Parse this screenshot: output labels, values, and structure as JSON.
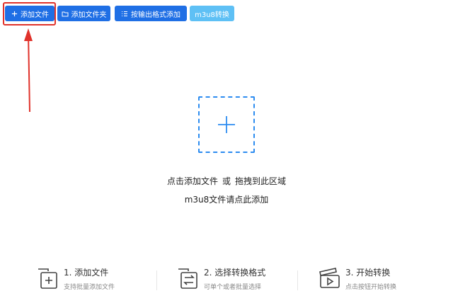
{
  "toolbar": {
    "add_file": "添加文件",
    "add_folder": "添加文件夹",
    "add_by_format": "按输出格式添加",
    "m3u8": "m3u8转换"
  },
  "dropzone": {
    "hint_left": "点击添加文件",
    "hint_or": "或",
    "hint_right": "拖拽到此区域",
    "hint_m3u8": "m3u8文件请点此添加"
  },
  "steps": [
    {
      "title": "1. 添加文件",
      "desc": "支持批量添加文件",
      "icon": "add-file-icon"
    },
    {
      "title": "2. 选择转换格式",
      "desc": "可单个或者批量选择",
      "icon": "convert-format-icon"
    },
    {
      "title": "3. 开始转换",
      "desc": "点击按钮开始转换",
      "icon": "clapperboard-play-icon"
    }
  ],
  "colors": {
    "primary": "#1f6fe5",
    "light": "#5ec0f5",
    "dashed": "#2d8cf0",
    "annotation": "#e0322b"
  }
}
